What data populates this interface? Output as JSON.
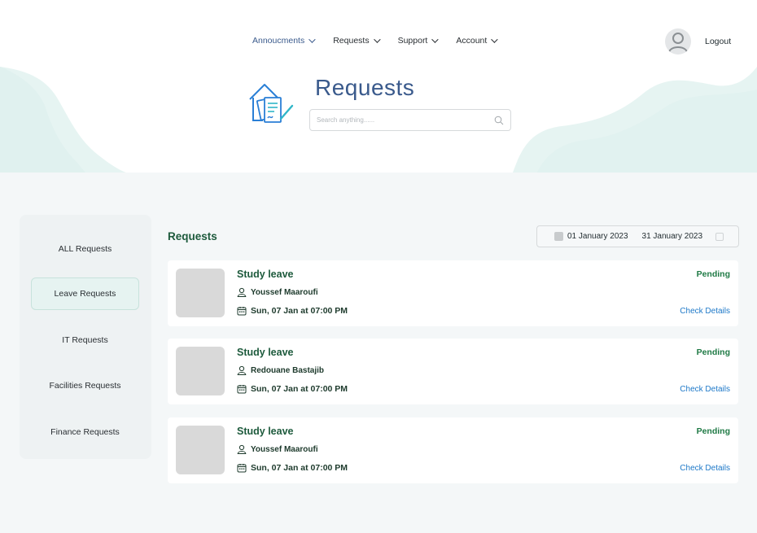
{
  "nav": {
    "items": [
      {
        "label": "Annoucments",
        "active": true
      },
      {
        "label": "Requests",
        "active": false
      },
      {
        "label": "Support",
        "active": false
      },
      {
        "label": "Account",
        "active": false
      }
    ],
    "logout_label": "Logout"
  },
  "hero": {
    "title": "Requests",
    "search_placeholder": "Search anything......"
  },
  "sidebar": {
    "items": [
      {
        "label": "ALL Requests",
        "active": false
      },
      {
        "label": "Leave Requests",
        "active": true
      },
      {
        "label": "IT Requests",
        "active": false
      },
      {
        "label": "Facilities Requests",
        "active": false
      },
      {
        "label": "Finance Requests",
        "active": false
      }
    ]
  },
  "main": {
    "title": "Requests",
    "date_from": "01 January 2023",
    "date_to": "31 January 2023",
    "requests": [
      {
        "title": "Study leave",
        "user": "Youssef Maaroufi",
        "date": "Sun, 07 Jan at 07:00 PM",
        "status": "Pending",
        "action": "Check Details"
      },
      {
        "title": "Study leave",
        "user": "Redouane Bastajib",
        "date": "Sun, 07 Jan at 07:00 PM",
        "status": "Pending",
        "action": "Check Details"
      },
      {
        "title": "Study leave",
        "user": "Youssef Maaroufi",
        "date": "Sun, 07 Jan at 07:00 PM",
        "status": "Pending",
        "action": "Check Details"
      }
    ]
  },
  "colors": {
    "accent_blue": "#3a5a8c",
    "accent_green": "#1d5a3c",
    "status_green": "#1f7a45",
    "link_blue": "#1d78c8",
    "wave_mint": "#e6f4f2"
  },
  "icons": {
    "nav_chevron": "chevron-down-icon",
    "avatar": "user-avatar-icon",
    "hero": "documents-house-icon",
    "search": "search-icon",
    "user": "user-icon",
    "calendar": "calendar-icon"
  }
}
